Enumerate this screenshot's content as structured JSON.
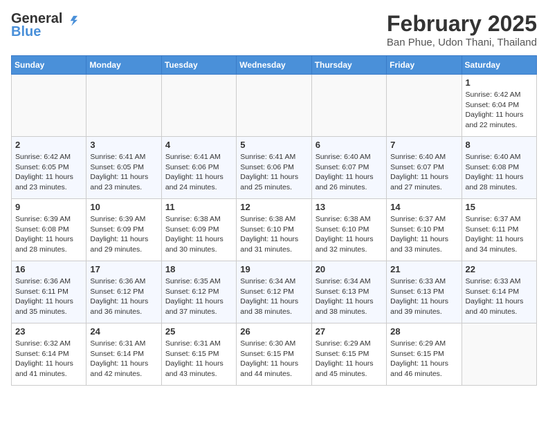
{
  "header": {
    "logo_general": "General",
    "logo_blue": "Blue",
    "month_title": "February 2025",
    "location": "Ban Phue, Udon Thani, Thailand"
  },
  "weekdays": [
    "Sunday",
    "Monday",
    "Tuesday",
    "Wednesday",
    "Thursday",
    "Friday",
    "Saturday"
  ],
  "weeks": [
    [
      {
        "day": "",
        "info": ""
      },
      {
        "day": "",
        "info": ""
      },
      {
        "day": "",
        "info": ""
      },
      {
        "day": "",
        "info": ""
      },
      {
        "day": "",
        "info": ""
      },
      {
        "day": "",
        "info": ""
      },
      {
        "day": "1",
        "info": "Sunrise: 6:42 AM\nSunset: 6:04 PM\nDaylight: 11 hours\nand 22 minutes."
      }
    ],
    [
      {
        "day": "2",
        "info": "Sunrise: 6:42 AM\nSunset: 6:05 PM\nDaylight: 11 hours\nand 23 minutes."
      },
      {
        "day": "3",
        "info": "Sunrise: 6:41 AM\nSunset: 6:05 PM\nDaylight: 11 hours\nand 23 minutes."
      },
      {
        "day": "4",
        "info": "Sunrise: 6:41 AM\nSunset: 6:06 PM\nDaylight: 11 hours\nand 24 minutes."
      },
      {
        "day": "5",
        "info": "Sunrise: 6:41 AM\nSunset: 6:06 PM\nDaylight: 11 hours\nand 25 minutes."
      },
      {
        "day": "6",
        "info": "Sunrise: 6:40 AM\nSunset: 6:07 PM\nDaylight: 11 hours\nand 26 minutes."
      },
      {
        "day": "7",
        "info": "Sunrise: 6:40 AM\nSunset: 6:07 PM\nDaylight: 11 hours\nand 27 minutes."
      },
      {
        "day": "8",
        "info": "Sunrise: 6:40 AM\nSunset: 6:08 PM\nDaylight: 11 hours\nand 28 minutes."
      }
    ],
    [
      {
        "day": "9",
        "info": "Sunrise: 6:39 AM\nSunset: 6:08 PM\nDaylight: 11 hours\nand 28 minutes."
      },
      {
        "day": "10",
        "info": "Sunrise: 6:39 AM\nSunset: 6:09 PM\nDaylight: 11 hours\nand 29 minutes."
      },
      {
        "day": "11",
        "info": "Sunrise: 6:38 AM\nSunset: 6:09 PM\nDaylight: 11 hours\nand 30 minutes."
      },
      {
        "day": "12",
        "info": "Sunrise: 6:38 AM\nSunset: 6:10 PM\nDaylight: 11 hours\nand 31 minutes."
      },
      {
        "day": "13",
        "info": "Sunrise: 6:38 AM\nSunset: 6:10 PM\nDaylight: 11 hours\nand 32 minutes."
      },
      {
        "day": "14",
        "info": "Sunrise: 6:37 AM\nSunset: 6:10 PM\nDaylight: 11 hours\nand 33 minutes."
      },
      {
        "day": "15",
        "info": "Sunrise: 6:37 AM\nSunset: 6:11 PM\nDaylight: 11 hours\nand 34 minutes."
      }
    ],
    [
      {
        "day": "16",
        "info": "Sunrise: 6:36 AM\nSunset: 6:11 PM\nDaylight: 11 hours\nand 35 minutes."
      },
      {
        "day": "17",
        "info": "Sunrise: 6:36 AM\nSunset: 6:12 PM\nDaylight: 11 hours\nand 36 minutes."
      },
      {
        "day": "18",
        "info": "Sunrise: 6:35 AM\nSunset: 6:12 PM\nDaylight: 11 hours\nand 37 minutes."
      },
      {
        "day": "19",
        "info": "Sunrise: 6:34 AM\nSunset: 6:12 PM\nDaylight: 11 hours\nand 38 minutes."
      },
      {
        "day": "20",
        "info": "Sunrise: 6:34 AM\nSunset: 6:13 PM\nDaylight: 11 hours\nand 38 minutes."
      },
      {
        "day": "21",
        "info": "Sunrise: 6:33 AM\nSunset: 6:13 PM\nDaylight: 11 hours\nand 39 minutes."
      },
      {
        "day": "22",
        "info": "Sunrise: 6:33 AM\nSunset: 6:14 PM\nDaylight: 11 hours\nand 40 minutes."
      }
    ],
    [
      {
        "day": "23",
        "info": "Sunrise: 6:32 AM\nSunset: 6:14 PM\nDaylight: 11 hours\nand 41 minutes."
      },
      {
        "day": "24",
        "info": "Sunrise: 6:31 AM\nSunset: 6:14 PM\nDaylight: 11 hours\nand 42 minutes."
      },
      {
        "day": "25",
        "info": "Sunrise: 6:31 AM\nSunset: 6:15 PM\nDaylight: 11 hours\nand 43 minutes."
      },
      {
        "day": "26",
        "info": "Sunrise: 6:30 AM\nSunset: 6:15 PM\nDaylight: 11 hours\nand 44 minutes."
      },
      {
        "day": "27",
        "info": "Sunrise: 6:29 AM\nSunset: 6:15 PM\nDaylight: 11 hours\nand 45 minutes."
      },
      {
        "day": "28",
        "info": "Sunrise: 6:29 AM\nSunset: 6:15 PM\nDaylight: 11 hours\nand 46 minutes."
      },
      {
        "day": "",
        "info": ""
      }
    ]
  ]
}
